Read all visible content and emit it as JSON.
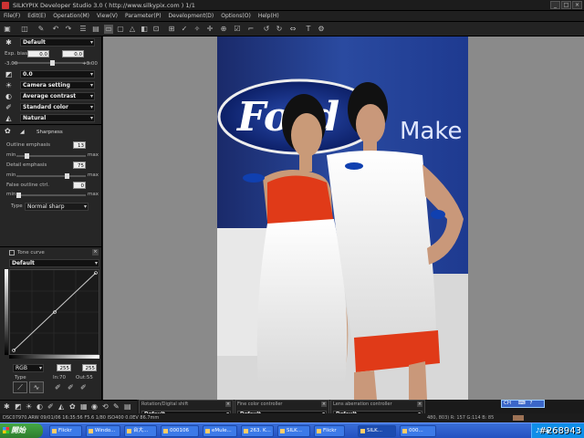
{
  "window": {
    "title": "SILKYPIX Developer Studio 3.0 ( http://www.silkypix.com )    1/1",
    "buttons": [
      "_",
      "□",
      "×"
    ]
  },
  "menu": [
    "File(F)",
    "Edit(E)",
    "Operation(M)",
    "View(V)",
    "Parameter(P)",
    "Development(D)",
    "Options(O)",
    "Help(H)"
  ],
  "left_panel": {
    "taste_preset": "Default",
    "exposure": {
      "label": "Exp. bias",
      "value1": "0.0",
      "value2": "0.0",
      "min": "-3.00",
      "max": "+3.00",
      "level": 0.5
    },
    "wb_value": "0.0",
    "camera_setting": "Camera setting",
    "contrast": "Average contrast",
    "color": "Standard color",
    "tone": "Natural",
    "sharpness": {
      "title": "Sharpness",
      "outline_label": "Outline emphasis",
      "outline_value": "13",
      "outline_level": 0.13,
      "detail_label": "Detail emphasis",
      "detail_value": "75",
      "detail_level": 0.75,
      "false_label": "False outline ctrl.",
      "false_value": "0",
      "false_level": 0.0,
      "min": "min",
      "max": "max",
      "type_label": "Type",
      "type_value": "Normal sharp"
    },
    "tone_curve": {
      "title": "Tone curve",
      "preset": "Default",
      "channel": "RGB",
      "in_value": "255",
      "out_value": "255",
      "type_label": "Type",
      "in_label": "In:70",
      "out_label": "Out:55"
    }
  },
  "bottom_panels": [
    {
      "title": "Rotation/Digital shift",
      "value": "Default"
    },
    {
      "title": "Fine color controller",
      "value": "Default"
    },
    {
      "title": "Lens aberration controller",
      "value": "Default"
    }
  ],
  "status": {
    "file": "DSC07970.ARW 09/01/06 16:35:56 F5.6 1/80 ISO400 0.0EV 86.7mm",
    "pixel": "480, 803) R: 157 G:114 B: 85",
    "ime": "CH"
  },
  "taskbar": {
    "start": "開始",
    "items": [
      "Flickr",
      "Windo...",
      "台大...",
      "000106",
      "eMule...",
      "263. K...",
      "SILK...",
      "Flickr",
      "SILK...",
      "000..."
    ]
  },
  "watermark": "#268943",
  "colors": {
    "accent": "#2350c0",
    "panel": "#262626",
    "viewer": "#8a8a8a"
  }
}
